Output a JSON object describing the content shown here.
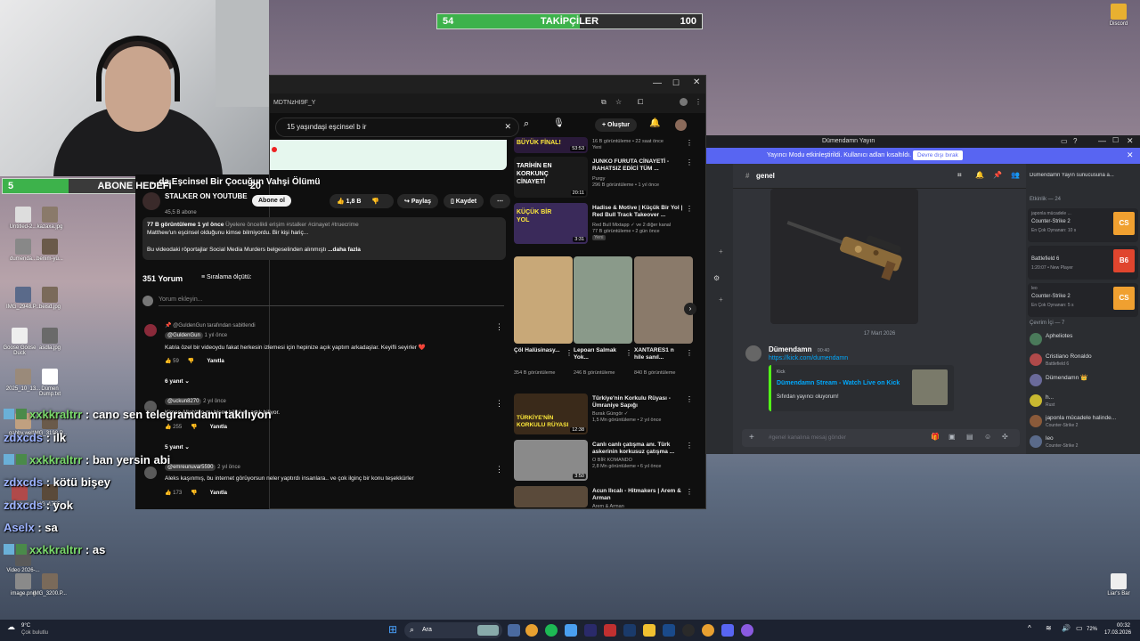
{
  "overlay": {
    "followers_goal": {
      "current": "54",
      "label": "TAKİPÇİLER",
      "target": "100",
      "progress": 0.54
    },
    "sub_goal": {
      "current": "5",
      "label": "ABONE HEDEFİ",
      "target": "20",
      "progress": 0.25
    }
  },
  "desktop_icons": [
    {
      "label": "Untitled-2..."
    },
    {
      "label": "kazaxa.jpg"
    },
    {
      "label": "dumenda..."
    },
    {
      "label": "benim-yü..."
    },
    {
      "label": "IMG_2948.P..."
    },
    {
      "label": "beisd.jpg"
    },
    {
      "label": "Goose Goose Duck"
    },
    {
      "label": "asdla.jpg"
    },
    {
      "label": "2025_10_13..."
    },
    {
      "label": "Dümen Dump.txt"
    },
    {
      "label": "gabby.webp"
    },
    {
      "label": "IMG_3198.P..."
    },
    {
      "label": "bugs-dum..."
    },
    {
      "label": "IMG_1755..."
    },
    {
      "label": "Video 2026-..."
    },
    {
      "label": "image.png"
    },
    {
      "label": "IMG_3200.P..."
    }
  ],
  "desktop_right": {
    "discord_label": "Discord",
    "liars_bar_label": "Liar's Bar"
  },
  "browser": {
    "url": "MDTNzHI9F_Y"
  },
  "youtube": {
    "search_value": "15 yaşındaşi eşcinsel b ir",
    "create_label": "Oluştur",
    "video_title": "...da Eşcinsel Bir Çocuğun Vahşi Ölümü",
    "channel_name": "STALKER ON YOUTUBE",
    "subscribers": "45,5 B abone",
    "subscribe_label": "Abone ol",
    "likes": "1,8 B",
    "share_label": "Paylaş",
    "save_label": "Kaydet",
    "desc_stats": "77 B görüntüleme  1 yıl önce",
    "desc_tags": "Üyelere öncelikli erişim #stalker #cinayet #truecrime",
    "desc_line1": "Matthew'un eşcinsel olduğunu kimse bilmiyordu. Bir kişi hariç...",
    "desc_line2": "Bu videodaki röportajlar Social Media Murders belgeselinden alınmıştı",
    "desc_more": "...daha fazla",
    "comment_count": "351 Yorum",
    "sort_label": "Sıralama ölçütü:",
    "comment_placeholder": "Yorum ekleyin...",
    "comments": [
      {
        "pinned": "@GuldenGun tarafından sabitlendi",
        "author": "@GuldenGun",
        "time": "1 yıl önce",
        "text": "Katıla özel bir videoydu fakat herkesin izlemesi için hepinize açık yaptım arkadaşlar. Keyifli seyirler ❤️",
        "likes": "59",
        "reply": "Yanıtla",
        "replies": "6 yanıt"
      },
      {
        "author": "@uckun8270",
        "time": "2 yıl önce",
        "text": "Kimse Allah'tan mı bişey bilmiyor artık biliyor.",
        "likes": "255",
        "reply": "Yanıtla",
        "replies": "5 yanıt"
      },
      {
        "author": "@emreunuvar5590",
        "time": "2 yıl önce",
        "text": "Aleks kaşınmış, bu internet görüyorsun neler yaptırdı insanlara.. ve çok ilginç bir konu teşekkürler",
        "likes": "173",
        "reply": "Yanıtla"
      }
    ],
    "recs": [
      {
        "title": "",
        "meta1": "16 B görüntüleme • 22 saat önce",
        "meta2": "Yeni",
        "thumb": "BÜYÜK FİNAL!",
        "dur": "53:53"
      },
      {
        "title": "JUNKO FURUTA CİNAYETİ - RAHATSIZ EDİCİ TÜM ...",
        "meta1": "Purgy",
        "meta2": "296 B görüntüleme • 1 yıl önce",
        "thumb": "TARİHİN EN KORKUNÇ CİNAYETİ",
        "dur": "20:11"
      },
      {
        "title": "Hadise & Motive | Küçük Bir Yol | Red Bull Track Takeover ...",
        "meta1": "Red Bull Mixtapp ✓ ve 2 diğer kanal",
        "meta2": "77 B görüntüleme • 2 gün önce",
        "meta3": "Yeni",
        "thumb": "KÜÇÜK BİR YOL",
        "dur": "3:31"
      }
    ],
    "shorts": [
      {
        "title": "Çöl Halüsinasy...",
        "views": "354 B görüntüleme"
      },
      {
        "title": "Lepoarı Salmak Yok...",
        "views": "246 B görüntüleme"
      },
      {
        "title": "XANTARES1 n hile sanıl...",
        "views": "840 B görüntüleme"
      }
    ],
    "recs2": [
      {
        "title": "Türkiye'nin Korkulu Rüyası - Ümraniye Sapığı",
        "meta1": "Burak Güngör ✓",
        "meta2": "1,5 Mn görüntüleme • 2 yıl önce",
        "thumb": "TÜRKİYE'NİN KORKULU RÜYASI",
        "dur": "12:38"
      },
      {
        "title": "Canlı canlı çatışma anı. Türk askerinin korkusuz çatışma ...",
        "meta1": "O BİR KOMANDO",
        "meta2": "2,8 Mn görüntüleme • 6 yıl önce",
        "thumb": "",
        "dur": "3:50"
      },
      {
        "title": "Acun Ilıcalı - Hitmakers | Arem & Arman",
        "meta1": "Arem & Arman",
        "meta2": "",
        "thumb": "",
        "dur": ""
      }
    ]
  },
  "discord": {
    "window_title": "Dümendamn Yayın",
    "banner_text": "Yayıncı Modu etkinleştirildi. Kullanıcı adları kısaltıldı.",
    "banner_button": "Devre dışı bırak",
    "channel": "genel",
    "server_header": "Dümendamn Yayın sunucusuna a...",
    "date_divider": "17 Mart 2026",
    "message_author": "Dümendamn",
    "message_time": "00:40",
    "message_link": "https://kick.com/dumendamn",
    "embed_provider": "Kick",
    "embed_title": "Dümendamn Stream - Watch Live on Kick",
    "embed_desc": "Sıfırdan yayıncı oluyorum!",
    "input_placeholder": "#genel kanalına mesaj gönder",
    "activity_header": "Etkinlik — 24",
    "activities": [
      {
        "name": "japonla mücadele ...",
        "game": "Counter-Strike 2",
        "sub": "En Çok Oynanan: 10 s",
        "tile_color": "#f0a030",
        "tile": "CS"
      },
      {
        "name": "",
        "game": "Battlefield 6",
        "sub": "1:20:07 • New Player",
        "tile_color": "#e0452e",
        "tile": "B6"
      },
      {
        "name": "leo",
        "game": "Counter-Strike 2",
        "sub": "En Çok Oynanan: 5 s",
        "tile_color": "#f0a030",
        "tile": "CS"
      }
    ],
    "online_header": "Çevrim İçi — 7",
    "members": [
      {
        "name": "Apheliotes",
        "sub": "",
        "color": "#4a7a5a"
      },
      {
        "name": "Cristiano Ronaldo",
        "sub": "Battlefield 6",
        "color": "#b04a4a"
      },
      {
        "name": "Dümendamn 👑",
        "sub": "",
        "color": "#6a6a9a"
      },
      {
        "name": "h...",
        "sub": "Rust",
        "color": "#c8b830"
      },
      {
        "name": "japonla mücadele halinde...",
        "sub": "Counter-Strike 2",
        "color": "#8a5a3a"
      },
      {
        "name": "leo",
        "sub": "Counter-Strike 2",
        "color": "#5a6a8a"
      },
      {
        "name": "y...",
        "sub": "",
        "color": "#3a5a8a"
      }
    ]
  },
  "chat": [
    {
      "user": "xxkkraltrr",
      "msg": "cano sen telegramdamı takılıyon",
      "type": "u1"
    },
    {
      "user": "zdxcds",
      "msg": "ilk",
      "type": "u2"
    },
    {
      "user": "xxkkraltrr",
      "msg": "ban yersin abi",
      "type": "u1"
    },
    {
      "user": "zdxcds",
      "msg": "kötü bişey",
      "type": "u2"
    },
    {
      "user": "zdxcds",
      "msg": "yok",
      "type": "u2"
    },
    {
      "user": "Aselx",
      "msg": "sa",
      "type": "u2"
    },
    {
      "user": "xxkkraltrr",
      "msg": "as",
      "type": "u1"
    }
  ],
  "taskbar": {
    "weather_temp": "9°C",
    "weather_desc": "Çok bulutlu",
    "search_label": "Ara",
    "battery": "72%",
    "time": "00:32",
    "date": "17.03.2026"
  }
}
